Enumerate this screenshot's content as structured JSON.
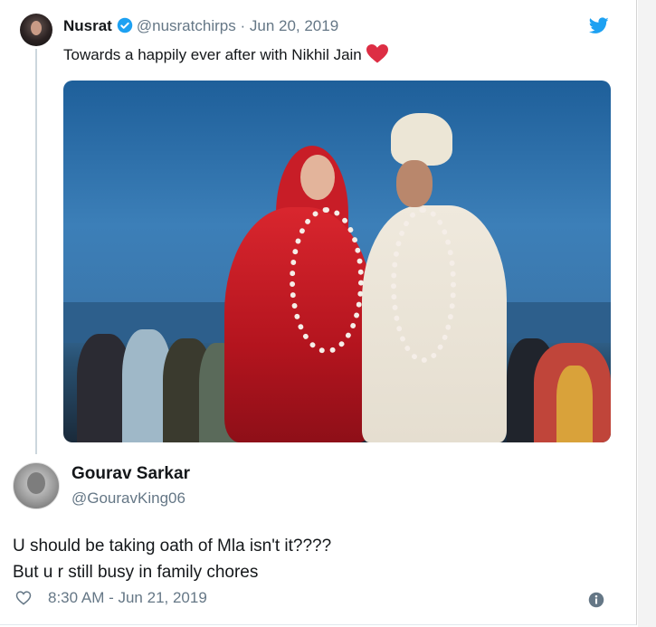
{
  "tweet": {
    "author_name": "Nusrat",
    "handle": "@nusratchirps",
    "separator": "·",
    "date": "Jun 20, 2019",
    "text": "Towards a happily ever after with Nikhil Jain",
    "emoji": "red-heart-icon",
    "verified_icon": "verified-badge-icon",
    "brand_icon": "twitter-bird-icon"
  },
  "reply": {
    "author_name": "Gourav Sarkar",
    "handle": "@GouravKing06",
    "line1": "U should be taking oath of Mla isn't it????",
    "line2": "But u r still busy in family chores",
    "time": "8:30 AM - Jun 21, 2019",
    "like_icon": "heart-outline-icon",
    "info_icon": "info-icon"
  },
  "colors": {
    "twitter_blue": "#1da1f2",
    "text_primary": "#14171a",
    "text_secondary": "#657786",
    "heart_red": "#e0245e",
    "thread_line": "#ccd6dd"
  }
}
